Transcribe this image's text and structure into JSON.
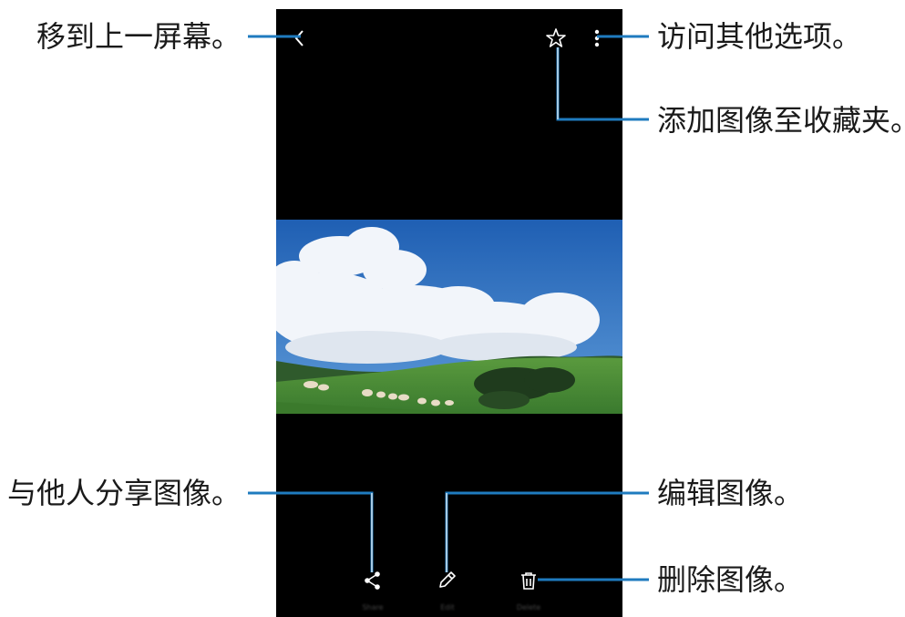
{
  "callouts": {
    "back": "移到上一屏幕。",
    "more_options": "访问其他选项。",
    "favorite": "添加图像至收藏夹。",
    "share": "与他人分享图像。",
    "edit": "编辑图像。",
    "delete": "删除图像。"
  },
  "toolbar": {
    "top": [
      "back-icon",
      "star-icon",
      "more-options-icon"
    ],
    "bottom": [
      "share-icon",
      "edit-pencil-icon",
      "delete-trash-icon"
    ],
    "bottom_labels": [
      "Share",
      "Edit",
      "Delete"
    ]
  },
  "colors": {
    "phone_background": "#000000",
    "callout_line": "#1f7bbf",
    "icon": "#ffffff",
    "sky": "#2d6fc0",
    "grass": "#3d8a3a"
  }
}
